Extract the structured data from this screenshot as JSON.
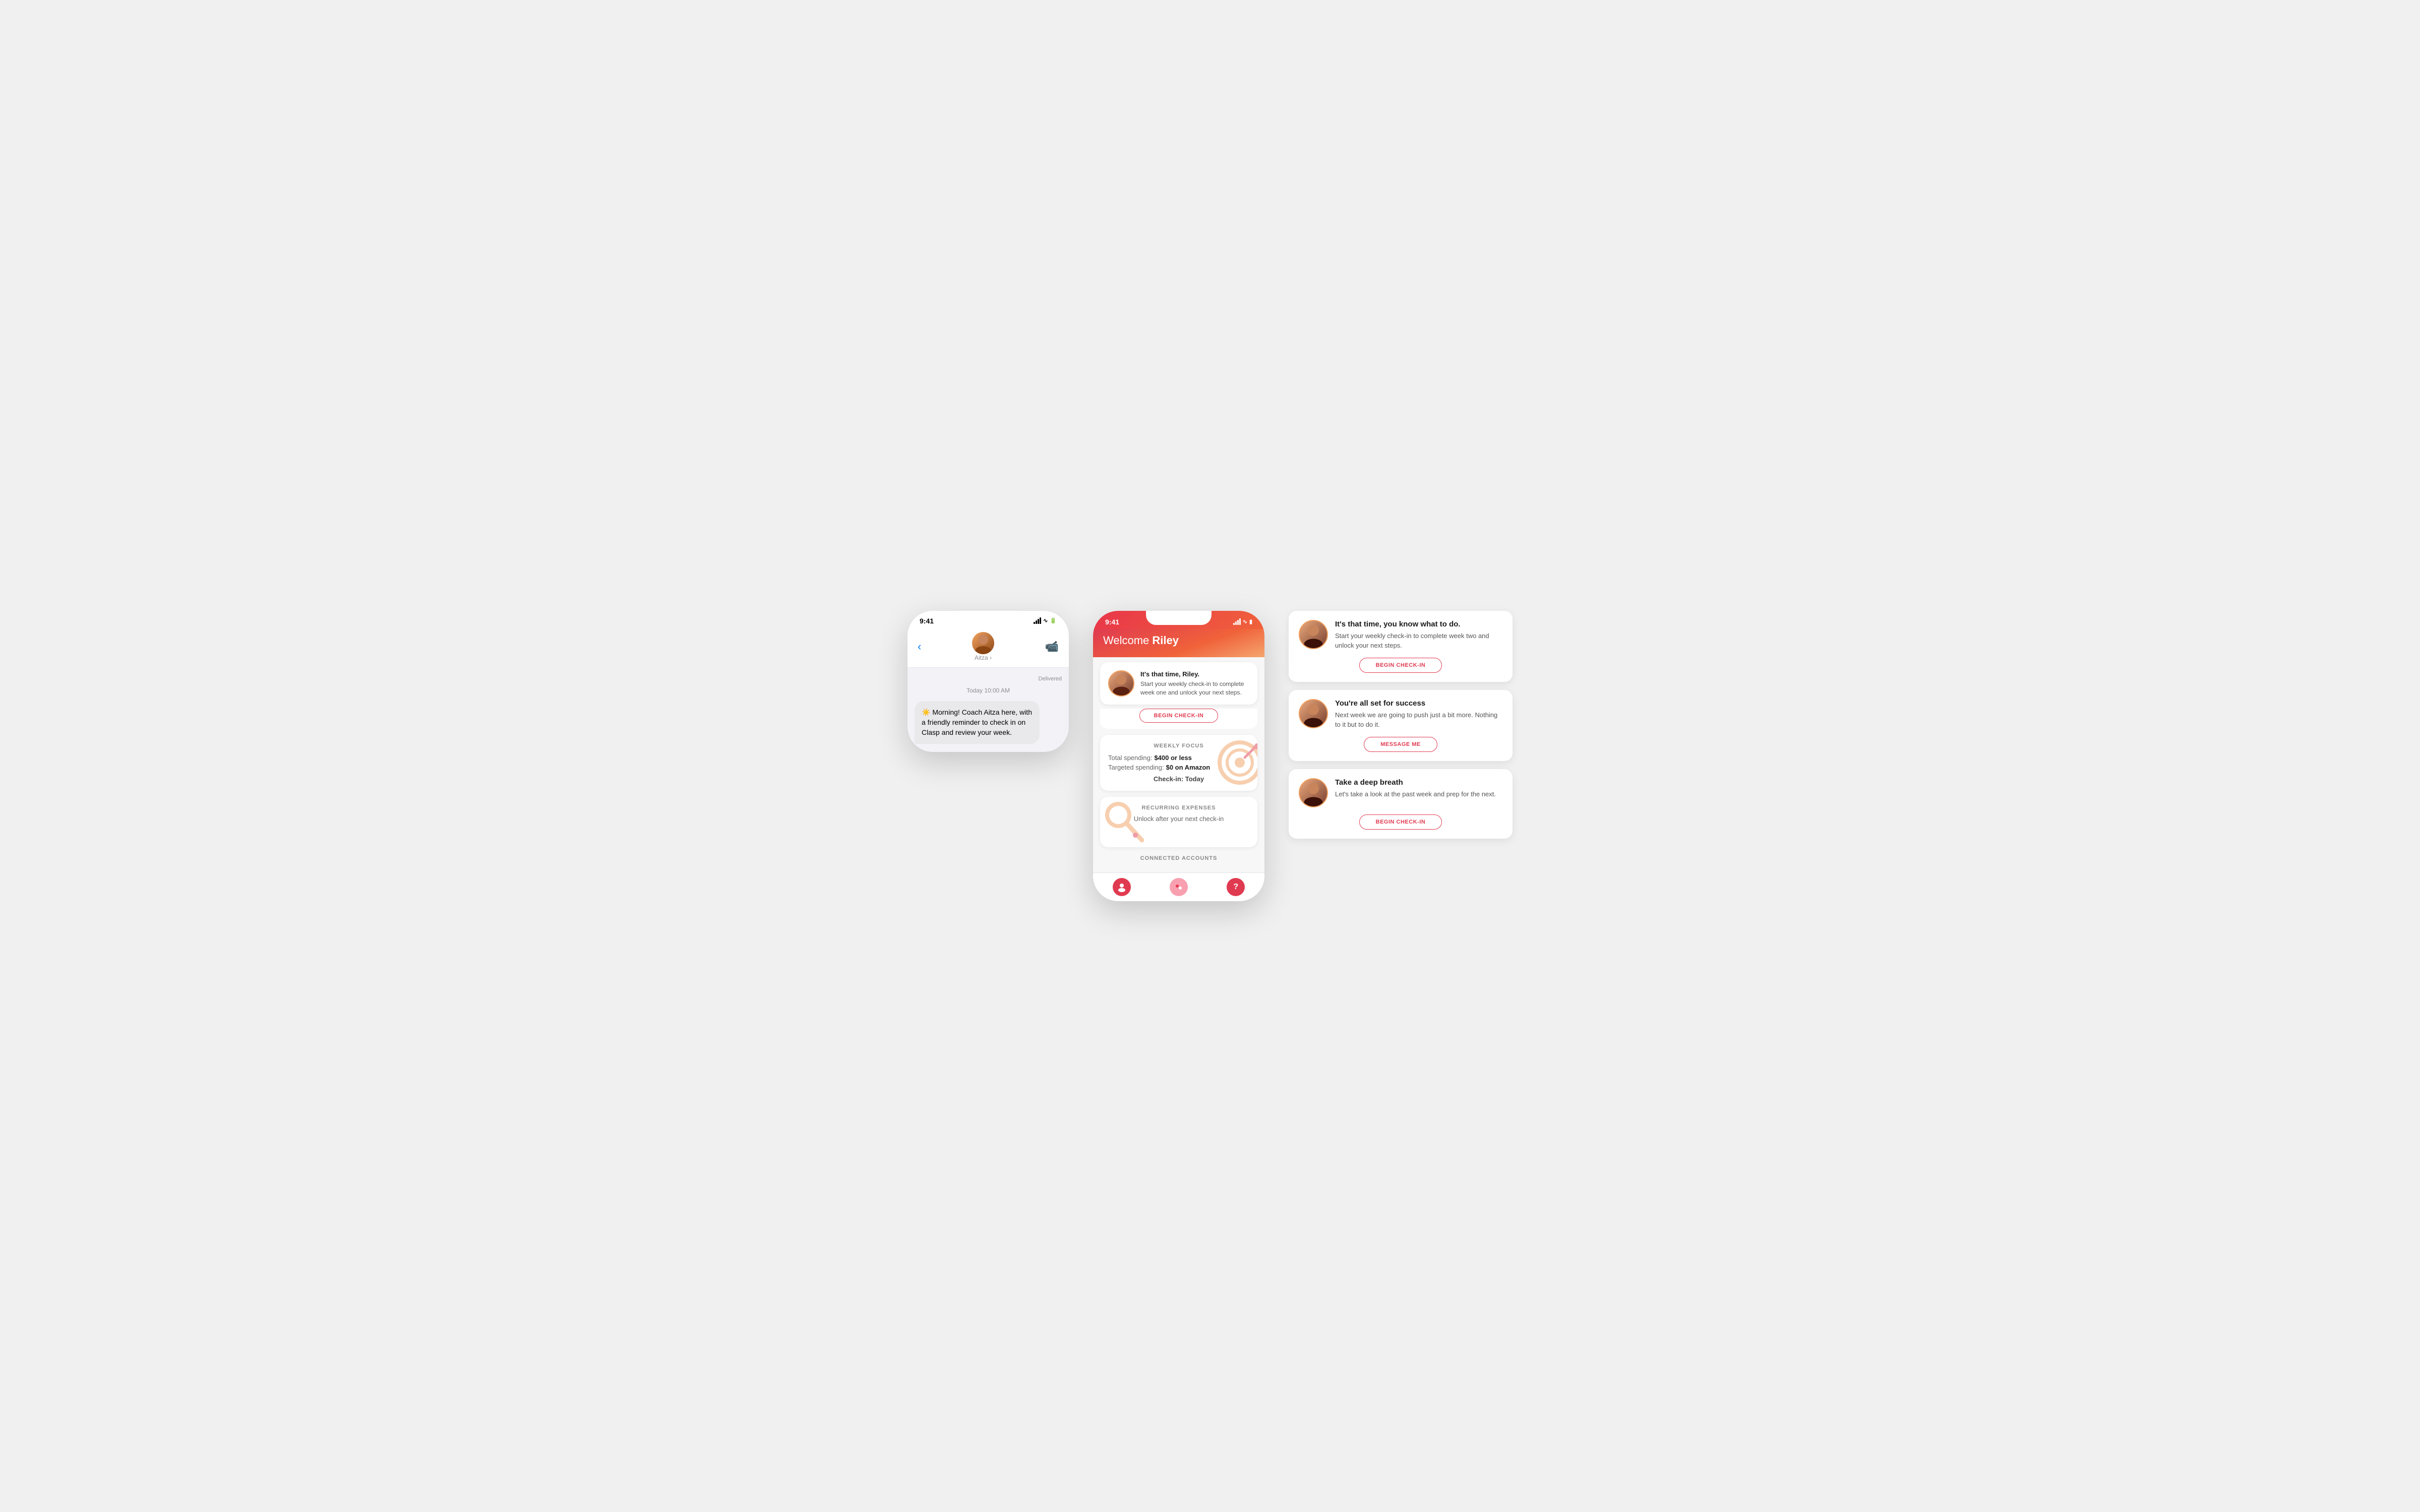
{
  "colors": {
    "primary": "#e03a50",
    "gradient_start": "#e03a50",
    "gradient_end": "#f5a56e",
    "ios_blue": "#007aff",
    "text_dark": "#1a1a1a",
    "text_medium": "#555",
    "text_light": "#8e8e93"
  },
  "phone_msg": {
    "status_time": "9:41",
    "contact_name": "Aitza",
    "contact_chevron": "›",
    "delivered_label": "Delivered",
    "date_label": "Today 10:00 AM",
    "message": "☀️ Morning! Coach Aitza here, with a friendly reminder to check in on Clasp and review your week."
  },
  "phone_app": {
    "status_time": "9:41",
    "welcome_prefix": "Welcome ",
    "welcome_name": "Riley",
    "checkin_card": {
      "title": "It's that time, Riley.",
      "description": "Start your weekly check-in to complete week one and unlock your next steps.",
      "button_label": "BEGIN CHECK-IN"
    },
    "weekly_focus": {
      "section_title": "WEEKLY FOCUS",
      "total_spending_label": "Total spending:",
      "total_spending_value": "$400 or less",
      "targeted_spending_label": "Targeted spending:",
      "targeted_spending_value": "$0 on Amazon",
      "checkin_label": "Check-in:",
      "checkin_value": "Today"
    },
    "recurring_expenses": {
      "section_title": "RECURRING EXPENSES",
      "unlock_text": "Unlock after your next check-in"
    },
    "connected_accounts": {
      "section_title": "CONNECTED ACCOUNTS"
    }
  },
  "coach_cards": [
    {
      "title": "It's that time, you know what to do.",
      "description": "Start your weekly check-in to complete week two and unlock your next steps.",
      "button_label": "BEGIN CHECK-IN"
    },
    {
      "title": "You're all set for success",
      "description": "Next week we are going to push just a bit more. Nothing to it but to do it.",
      "button_label": "MESSAGE ME"
    },
    {
      "title": "Take a deep breath",
      "description": "Let's take a look at the past week and prep for the next.",
      "button_label": "BEGIN CHECK-IN"
    }
  ]
}
